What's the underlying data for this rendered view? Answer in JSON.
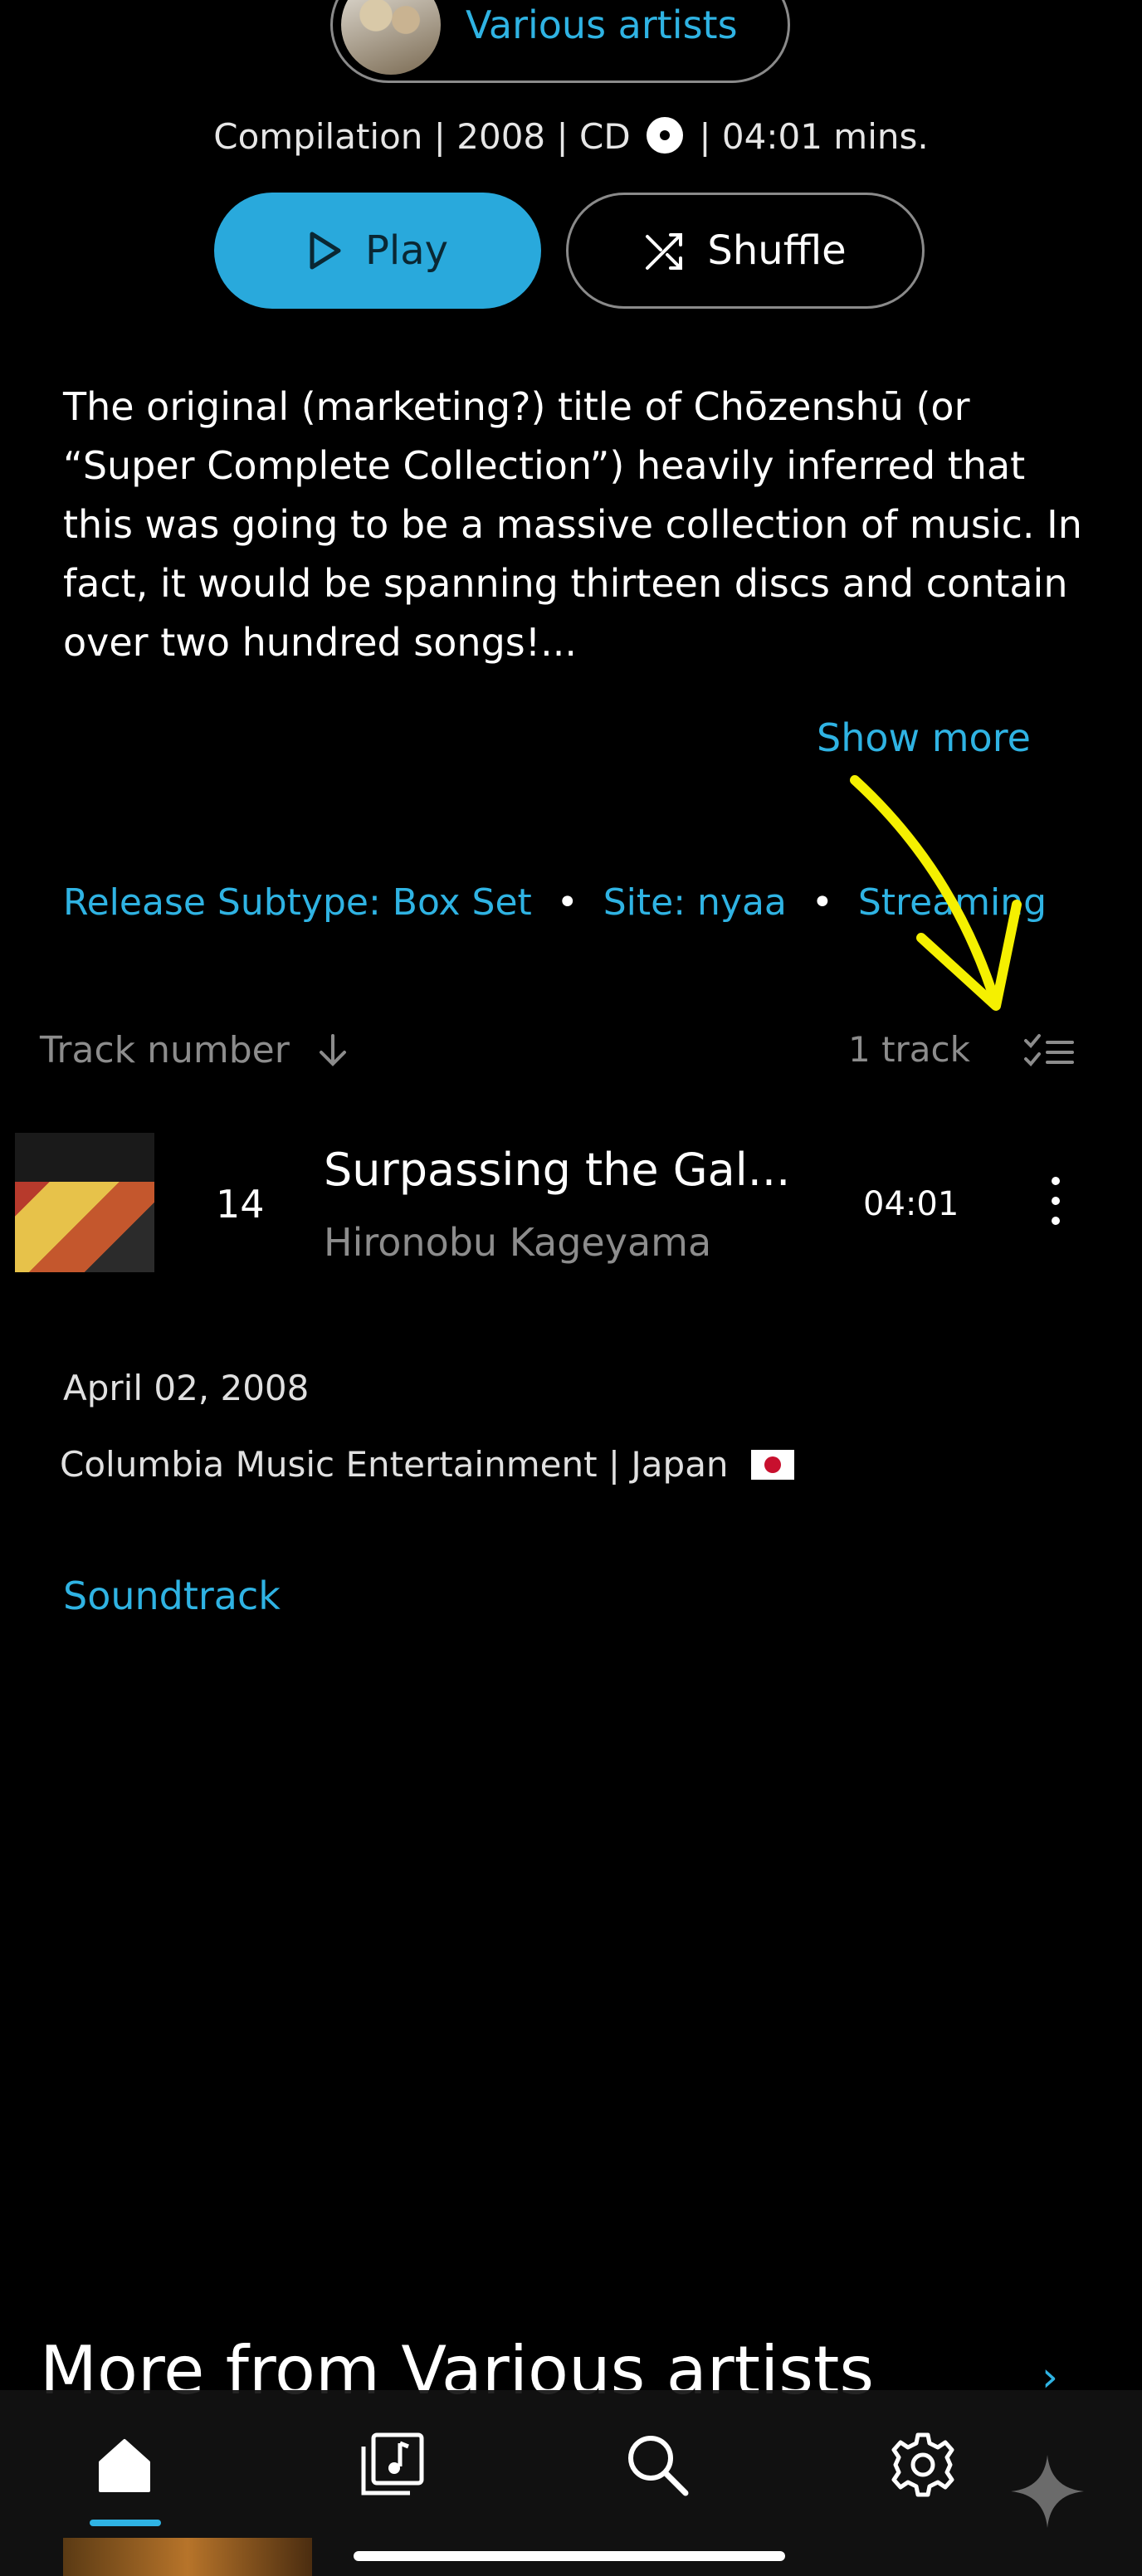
{
  "header": {
    "artist_name": "Various artists",
    "meta_line_left": "Compilation | 2008 | CD",
    "meta_line_right": "| 04:01 mins."
  },
  "actions": {
    "play_label": "Play",
    "shuffle_label": "Shuffle"
  },
  "description": {
    "text": "The original (marketing?) title of Chōzenshū (or “Super Complete Collection”) heavily inferred that this was going to be a massive collection of music. In fact, it would be spanning thirteen discs and contain over two hundred songs!...",
    "show_more": "Show more"
  },
  "tags": [
    "Release Subtype: Box Set",
    "Site: nyaa",
    "Streaming"
  ],
  "tracklist_header": {
    "sort_label": "Track number",
    "count": "1 track"
  },
  "tracks": [
    {
      "number": "14",
      "title": "Surpassing the Gal...",
      "artist": "Hironobu Kageyama",
      "duration": "04:01"
    }
  ],
  "release_info": {
    "date": "April 02, 2008",
    "label_country": "Columbia Music Entertainment | Japan",
    "genre": "Soundtrack"
  },
  "more_from": {
    "title": "More from Various artists"
  },
  "nav": {
    "items": [
      "home-icon",
      "library-icon",
      "search-icon",
      "settings-icon"
    ]
  },
  "colors": {
    "accent": "#2fb3e3",
    "play_button": "#29a9dc",
    "annotation": "#f5f000"
  }
}
